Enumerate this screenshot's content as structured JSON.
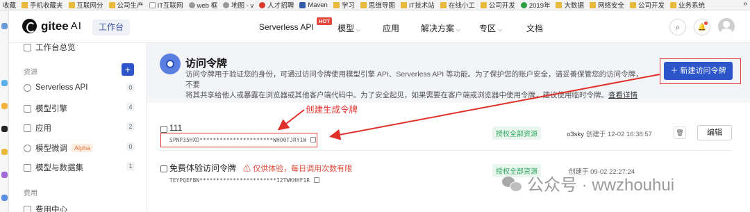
{
  "bookmarks": {
    "items": [
      {
        "label": "收藏",
        "icon": "none"
      },
      {
        "label": "手机收藏夹",
        "icon": "folder"
      },
      {
        "label": "互联网分",
        "icon": "folder"
      },
      {
        "label": "公司生产",
        "icon": "folder"
      },
      {
        "label": "IT互联网",
        "icon": "page"
      },
      {
        "label": "web 框",
        "icon": "gray"
      },
      {
        "label": "地图 - v",
        "icon": "gray"
      },
      {
        "label": "人才招聘",
        "icon": "red"
      },
      {
        "label": "Maven",
        "icon": "maven"
      },
      {
        "label": "学习",
        "icon": "folder"
      },
      {
        "label": "思维导图",
        "icon": "folder"
      },
      {
        "label": "IT技术站",
        "icon": "folder"
      },
      {
        "label": "在线小工",
        "icon": "folder"
      },
      {
        "label": "公司开发",
        "icon": "folder"
      },
      {
        "label": "2019年",
        "icon": "green"
      },
      {
        "label": "大数据",
        "icon": "folder"
      },
      {
        "label": "网络安全",
        "icon": "folder"
      },
      {
        "label": "公司开发",
        "icon": "folder"
      },
      {
        "label": "业务系统",
        "icon": "folder"
      }
    ],
    "more": "»"
  },
  "topnav": {
    "logo_text": "gitee",
    "logo_ai": "AI",
    "workbench": "工作台",
    "serverless": "Serverless API",
    "hot_badge": "HOT",
    "model": "模型",
    "app": "应用",
    "solutions": "解决方案",
    "zone": "专区",
    "docs": "文档",
    "caret": "⌵",
    "search_icon": "⌕",
    "bell_icon": "🔔"
  },
  "sidebar": {
    "overview": "工作台总览",
    "section_resources": "资源",
    "add": "+",
    "items": [
      {
        "label": "Serverless API",
        "count": "0"
      },
      {
        "label": "模型引擎",
        "count": "4"
      },
      {
        "label": "应用",
        "count": "2"
      },
      {
        "label": "模型微调",
        "badge": "Alpha",
        "count": "0"
      },
      {
        "label": "模型与数据集",
        "count": "1"
      }
    ],
    "section_billing": "费用",
    "billing_center": "费用中心"
  },
  "main": {
    "title": "访问令牌",
    "desc_line1": "访问令牌用于验证您的身份，可通过访问令牌使用模型引擎 API、Serverless API 等功能。为了保护您的账户安全，请妥善保管您的访问令牌，不要",
    "desc_line2": "将其共享给他人或暴露在浏览器或其他客户端代码中。为了安全起见，如果需要在客户端或浏览器中使用令牌，建议使用临时令牌。",
    "more_link": "查看详情",
    "new_button": "＋  新建访问令牌",
    "annotation": "创建生成令牌",
    "tokens": [
      {
        "name": "111",
        "value": "SPNP35HXD**********************WHO0TJRY1W",
        "permission": "授权全部资源",
        "owner": "o3sky",
        "created": "创建于 12-02 16:38:57",
        "delete_icon": "🗑",
        "edit": "编辑"
      },
      {
        "name": "免费体验访问令牌",
        "warning": "⚠ 仅供体验，每日调用次数有限",
        "value": "TEYPQEFBN***********************I2TWKHHF1R",
        "permission": "授权全部资源",
        "created": "创建于 09-02 22:27:24"
      }
    ]
  },
  "watermark": "公众号 · wwzhouhui",
  "colors": {
    "primary": "#2b55c9",
    "annotation_red": "#e0302a",
    "permission_green": "#2fa75f"
  }
}
